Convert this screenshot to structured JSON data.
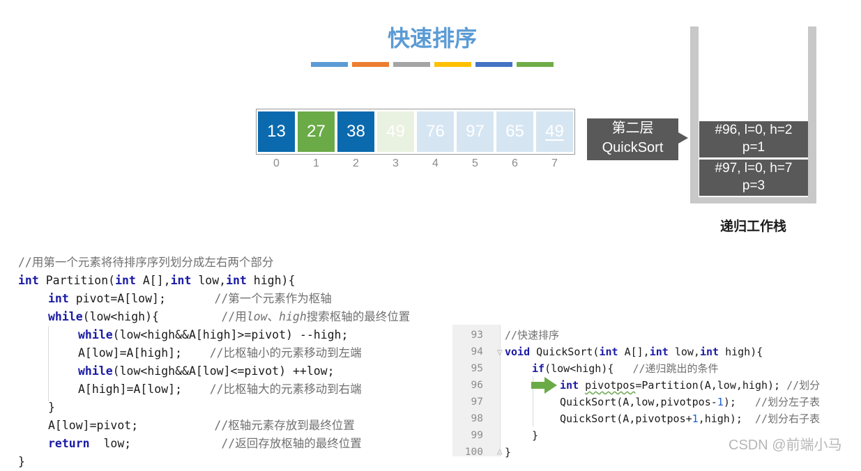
{
  "title": "快速排序",
  "stripe_colors": [
    "#5b9bd5",
    "#ed7d31",
    "#a5a5a5",
    "#ffc000",
    "#4472c4",
    "#70ad47"
  ],
  "array": {
    "cells": [
      {
        "value": "13",
        "color": "#0b6aae"
      },
      {
        "value": "27",
        "color": "#6aab47"
      },
      {
        "value": "38",
        "color": "#0b6aae"
      },
      {
        "value": "49",
        "color": "#e9f1e0"
      },
      {
        "value": "76",
        "color": "#d6e5f2"
      },
      {
        "value": "97",
        "color": "#d6e5f2"
      },
      {
        "value": "65",
        "color": "#d6e5f2"
      },
      {
        "value": "49",
        "color": "#d6e5f2"
      }
    ],
    "indices": [
      "0",
      "1",
      "2",
      "3",
      "4",
      "5",
      "6",
      "7"
    ]
  },
  "layer_label": {
    "line1": "第二层",
    "line2": "QuickSort"
  },
  "stack": {
    "label": "递归工作栈",
    "frames": [
      {
        "line1": "#96, l=0, h=2",
        "line2": "p=1"
      },
      {
        "line1": "#97, l=0, h=7",
        "line2": "p=3"
      }
    ]
  },
  "left_code": {
    "l0": "//用第一个元素将待排序序列划分成左右两个部分",
    "l1_kw1": "int",
    "l1_a": " Partition(",
    "l1_kw2": "int",
    "l1_b": " A[],",
    "l1_kw3": "int",
    "l1_c": " low,",
    "l1_kw4": "int",
    "l1_d": " high){",
    "l2_kw": "int",
    "l2_a": " pivot=A[low];       ",
    "l2_cm": "//第一个元素作为枢轴",
    "l3_kw": "while",
    "l3_a": "(low<high){         ",
    "l3_cm1": "//用",
    "l3_cm2": "low",
    "l3_cm3": "、",
    "l3_cm4": "high",
    "l3_cm5": "搜索枢轴的最终位置",
    "l4_kw": "while",
    "l4_a": "(low<high&&A[high]>=pivot) --high;",
    "l5_a": "A[low]=A[high];    ",
    "l5_cm": "//比枢轴小的元素移动到左端",
    "l6_kw": "while",
    "l6_a": "(low<high&&A[low]<=pivot) ++low;",
    "l7_a": "A[high]=A[low];    ",
    "l7_cm": "//比枢轴大的元素移动到右端",
    "l8": "}",
    "l9_a": "A[low]=pivot;           ",
    "l9_cm": "//枢轴元素存放到最终位置",
    "l10_kw": "return",
    "l10_a": "  low;             ",
    "l10_cm": "//返回存放枢轴的最终位置",
    "l11": "}"
  },
  "editor": {
    "line_numbers": [
      "93",
      "94",
      "95",
      "96",
      "97",
      "98",
      "99",
      "100"
    ],
    "e0": "//快速排序",
    "e1_kw1": "void",
    "e1_a": " QuickSort(",
    "e1_kw2": "int",
    "e1_b": " A[],",
    "e1_kw3": "int",
    "e1_c": " low,",
    "e1_kw4": "int",
    "e1_d": " high){",
    "e2_kw": "if",
    "e2_a": "(low<high){   ",
    "e2_cm": "//递归跳出的条件",
    "e3_kw": "int",
    "e3_sp": " ",
    "e3_sq": "pivotpos",
    "e3_a": "=Partition(A,low,high); ",
    "e3_cm": "//划分",
    "e4_a": "QuickSort(A,low,pivotpos-",
    "e4_num": "1",
    "e4_b": ");   ",
    "e4_cm": "//划分左子表",
    "e5_a": "QuickSort(A,pivotpos+",
    "e5_num": "1",
    "e5_b": ",high);  ",
    "e5_cm": "//划分右子表",
    "e6": "}",
    "e7": "}"
  },
  "watermark": "CSDN @前端小马"
}
